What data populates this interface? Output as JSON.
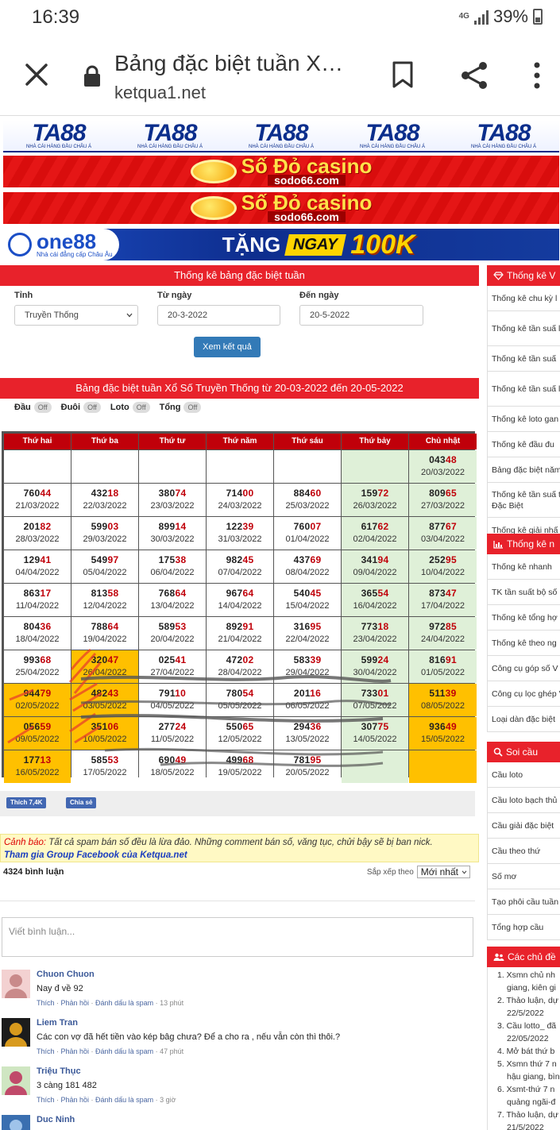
{
  "status": {
    "time": "16:39",
    "network": "4G",
    "battery": "39%"
  },
  "browser": {
    "title": "Bảng đặc biệt tuần X…",
    "url": "ketqua1.net"
  },
  "banners": {
    "ta88": {
      "brand": "TA88",
      "tagline": "NHÀ CÁI HÀNG ĐẦU CHÂU Á"
    },
    "sodo": {
      "brand": "Số Đỏ casino",
      "domain": "sodo66.com"
    },
    "one88": {
      "brand": "one88",
      "tagline": "Nhà cái đẳng cấp Châu Âu",
      "promo_1": "TẶNG",
      "promo_2": "NGAY",
      "promo_3": "100K"
    }
  },
  "form": {
    "title": "Thống kê bảng đặc biệt tuần",
    "province_label": "Tỉnh",
    "province_value": "Truyền Thống",
    "from_label": "Từ ngày",
    "from_value": "20-3-2022",
    "to_label": "Đến ngày",
    "to_value": "20-5-2022",
    "submit": "Xem kết quả"
  },
  "section": {
    "title": "Bảng đặc biệt tuần Xổ Số Truyền Thống từ 20-03-2022 đến 20-05-2022",
    "toggles": [
      {
        "label": "Đầu",
        "state": "Off"
      },
      {
        "label": "Đuôi",
        "state": "Off"
      },
      {
        "label": "Loto",
        "state": "Off"
      },
      {
        "label": "Tổng",
        "state": "Off"
      }
    ]
  },
  "table": {
    "headers": [
      "Thứ hai",
      "Thứ ba",
      "Thứ tư",
      "Thứ năm",
      "Thứ sáu",
      "Thứ bảy",
      "Chủ nhật"
    ],
    "rows": [
      [
        null,
        null,
        null,
        null,
        null,
        null,
        {
          "a": "043",
          "b": "48",
          "d": "20/03/2022"
        }
      ],
      [
        {
          "a": "760",
          "b": "44",
          "d": "21/03/2022"
        },
        {
          "a": "432",
          "b": "18",
          "d": "22/03/2022"
        },
        {
          "a": "380",
          "b": "74",
          "d": "23/03/2022"
        },
        {
          "a": "714",
          "b": "00",
          "d": "24/03/2022"
        },
        {
          "a": "884",
          "b": "60",
          "d": "25/03/2022"
        },
        {
          "a": "159",
          "b": "72",
          "d": "26/03/2022"
        },
        {
          "a": "809",
          "b": "65",
          "d": "27/03/2022"
        }
      ],
      [
        {
          "a": "201",
          "b": "82",
          "d": "28/03/2022"
        },
        {
          "a": "599",
          "b": "03",
          "d": "29/03/2022"
        },
        {
          "a": "899",
          "b": "14",
          "d": "30/03/2022"
        },
        {
          "a": "122",
          "b": "39",
          "d": "31/03/2022"
        },
        {
          "a": "760",
          "b": "07",
          "d": "01/04/2022"
        },
        {
          "a": "617",
          "b": "62",
          "d": "02/04/2022"
        },
        {
          "a": "877",
          "b": "67",
          "d": "03/04/2022"
        }
      ],
      [
        {
          "a": "129",
          "b": "41",
          "d": "04/04/2022"
        },
        {
          "a": "549",
          "b": "97",
          "d": "05/04/2022"
        },
        {
          "a": "175",
          "b": "38",
          "d": "06/04/2022"
        },
        {
          "a": "982",
          "b": "45",
          "d": "07/04/2022"
        },
        {
          "a": "437",
          "b": "69",
          "d": "08/04/2022"
        },
        {
          "a": "341",
          "b": "94",
          "d": "09/04/2022"
        },
        {
          "a": "252",
          "b": "95",
          "d": "10/04/2022"
        }
      ],
      [
        {
          "a": "863",
          "b": "17",
          "d": "11/04/2022"
        },
        {
          "a": "813",
          "b": "58",
          "d": "12/04/2022"
        },
        {
          "a": "768",
          "b": "64",
          "d": "13/04/2022"
        },
        {
          "a": "967",
          "b": "64",
          "d": "14/04/2022"
        },
        {
          "a": "540",
          "b": "45",
          "d": "15/04/2022"
        },
        {
          "a": "365",
          "b": "54",
          "d": "16/04/2022"
        },
        {
          "a": "873",
          "b": "47",
          "d": "17/04/2022"
        }
      ],
      [
        {
          "a": "804",
          "b": "36",
          "d": "18/04/2022"
        },
        {
          "a": "788",
          "b": "64",
          "d": "19/04/2022"
        },
        {
          "a": "589",
          "b": "53",
          "d": "20/04/2022"
        },
        {
          "a": "892",
          "b": "91",
          "d": "21/04/2022"
        },
        {
          "a": "316",
          "b": "95",
          "d": "22/04/2022"
        },
        {
          "a": "773",
          "b": "18",
          "d": "23/04/2022"
        },
        {
          "a": "972",
          "b": "85",
          "d": "24/04/2022"
        }
      ],
      [
        {
          "a": "993",
          "b": "68",
          "d": "25/04/2022"
        },
        {
          "a": "320",
          "b": "47",
          "d": "26/04/2022",
          "hl": true
        },
        {
          "a": "025",
          "b": "41",
          "d": "27/04/2022"
        },
        {
          "a": "472",
          "b": "02",
          "d": "28/04/2022"
        },
        {
          "a": "583",
          "b": "39",
          "d": "29/04/2022"
        },
        {
          "a": "599",
          "b": "24",
          "d": "30/04/2022"
        },
        {
          "a": "816",
          "b": "91",
          "d": "01/05/2022"
        }
      ],
      [
        {
          "a": "944",
          "b": "79",
          "d": "02/05/2022",
          "hl": true
        },
        {
          "a": "482",
          "b": "43",
          "d": "03/05/2022",
          "hl": true
        },
        {
          "a": "791",
          "b": "10",
          "d": "04/05/2022"
        },
        {
          "a": "780",
          "b": "54",
          "d": "05/05/2022"
        },
        {
          "a": "201",
          "b": "16",
          "d": "06/05/2022"
        },
        {
          "a": "733",
          "b": "01",
          "d": "07/05/2022"
        },
        {
          "a": "511",
          "b": "39",
          "d": "08/05/2022",
          "hl": true
        }
      ],
      [
        {
          "a": "056",
          "b": "59",
          "d": "09/05/2022",
          "hl": true
        },
        {
          "a": "351",
          "b": "06",
          "d": "10/05/2022",
          "hl": true
        },
        {
          "a": "277",
          "b": "24",
          "d": "11/05/2022"
        },
        {
          "a": "550",
          "b": "65",
          "d": "12/05/2022"
        },
        {
          "a": "294",
          "b": "36",
          "d": "13/05/2022"
        },
        {
          "a": "307",
          "b": "75",
          "d": "14/05/2022"
        },
        {
          "a": "936",
          "b": "49",
          "d": "15/05/2022",
          "hl": true
        }
      ],
      [
        {
          "a": "177",
          "b": "13",
          "d": "16/05/2022",
          "hl": true
        },
        {
          "a": "585",
          "b": "53",
          "d": "17/05/2022"
        },
        {
          "a": "690",
          "b": "49",
          "d": "18/05/2022"
        },
        {
          "a": "499",
          "b": "68",
          "d": "19/05/2022"
        },
        {
          "a": "781",
          "b": "95",
          "d": "20/05/2022"
        },
        null,
        {
          "hl": true
        }
      ]
    ]
  },
  "social": {
    "like": "Thích 7,4K",
    "share": "Chia sẻ"
  },
  "warning": {
    "label": "Cảnh báo:",
    "text": " Tất cả spam bán số đều là lừa đảo. Những comment bán số, văng tục, chửi bậy sẽ bị ban nick.",
    "link": "Tham gia Group Facebook của Ketqua.net"
  },
  "comments": {
    "count": "4324 bình luận",
    "sort_label": "Sắp xếp theo",
    "sort_value": "Mới nhất",
    "placeholder": "Viết bình luận...",
    "items": [
      {
        "name": "Chuon Chuon",
        "text": "Nay đ về 92",
        "time": "13 phút"
      },
      {
        "name": "Liem Tran",
        "text": "Các con vợ đã hết tiền vào kép bâg chưa? Để a cho ra , nếu vẫn còn thì thôi.?",
        "time": "47 phút"
      },
      {
        "name": "Triệu Thục",
        "text": "3 càng 181 482",
        "time": "3 giờ"
      },
      {
        "name": "Duc Ninh",
        "text": "",
        "time": ""
      }
    ],
    "actions": {
      "like": "Thích",
      "reply": "Phản hồi",
      "spam": "Đánh dấu là spam"
    }
  },
  "sidebar": {
    "block1": {
      "title": "Thống kê V",
      "items": [
        "Thống kê chu kỳ l",
        "Thống kê tần suấ loto",
        "Thống kê tần suấ",
        "Thống kê tần suấ loto",
        "Thống kê loto gan",
        "Thống kê đầu đu",
        "Bảng đặc biệt năm",
        "Thống kê tần suấ theo Đặc Biệt",
        "Thống kê giải nhấ"
      ]
    },
    "block2": {
      "title": "Thống kê n",
      "items": [
        "Thống kê nhanh",
        "TK tần suất bộ số",
        "Thống kê tổng hợ",
        "Thống kê theo ng",
        "Công cụ góp số V",
        "Công cụ lọc ghép VIP",
        "Loại dàn đặc biệt"
      ]
    },
    "block3": {
      "title": "Soi cầu",
      "items": [
        "Cầu loto",
        "Cầu loto bạch thủ",
        "Cầu giải đặc biệt",
        "Cầu theo thứ",
        "Số mơ",
        "Tạo phôi cầu tuần",
        "Tổng hợp cầu"
      ]
    },
    "block4": {
      "title": "Các chủ đề",
      "items": [
        "1. Xsmn chủ nh",
        "giang, kiên gi",
        "2. Thảo luận, dự",
        "22/5/2022",
        "3. Cầu lotto_ đã",
        "22/05/2022",
        "4. Mở bát thứ b",
        "5. Xsmn thứ 7 n",
        "hậu giang, bìn",
        "6. Xsmt-thứ 7 n",
        "quảng ngãi-đ",
        "7. Thảo luận, dự",
        "21/5/2022"
      ]
    }
  }
}
